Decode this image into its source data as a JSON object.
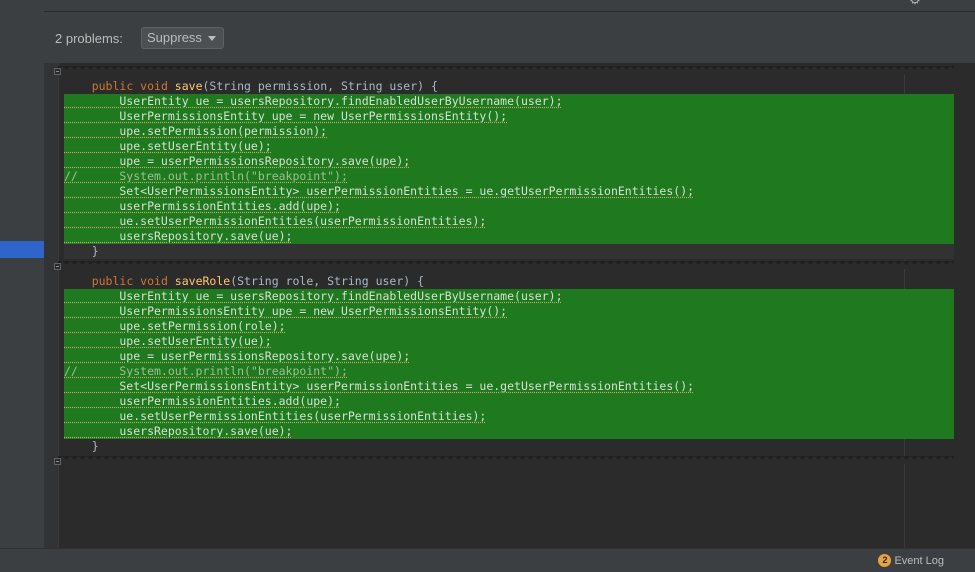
{
  "problems": {
    "count_label": "2 problems:",
    "suppress_label": "Suppress"
  },
  "code_blocks": [
    {
      "signature": {
        "pre": "public void ",
        "name": "save",
        "post": "(String permission, String user) {"
      },
      "body_lines": [
        "        UserEntity ue = usersRepository.findEnabledUserByUsername(user);",
        "        UserPermissionsEntity upe = new UserPermissionsEntity();",
        "        upe.setPermission(permission);",
        "        upe.setUserEntity(ue);",
        "        upe = userPermissionsRepository.save(upe);",
        "//      System.out.println(\"breakpoint\");",
        "        Set<UserPermissionsEntity> userPermissionEntities = ue.getUserPermissionEntities();",
        "        userPermissionEntities.add(upe);",
        "        ue.setUserPermissionEntities(userPermissionEntities);",
        "        usersRepository.save(ue);"
      ],
      "closing": "    }"
    },
    {
      "signature": {
        "pre": "public void ",
        "name": "saveRole",
        "post": "(String role, String user) {"
      },
      "body_lines": [
        "        UserEntity ue = usersRepository.findEnabledUserByUsername(user);",
        "        UserPermissionsEntity upe = new UserPermissionsEntity();",
        "        upe.setPermission(role);",
        "        upe.setUserEntity(ue);",
        "        upe = userPermissionsRepository.save(upe);",
        "//      System.out.println(\"breakpoint\");",
        "        Set<UserPermissionsEntity> userPermissionEntities = ue.getUserPermissionEntities();",
        "        userPermissionEntities.add(upe);",
        "        ue.setUserPermissionEntities(userPermissionEntities);",
        "        usersRepository.save(ue);"
      ],
      "closing": "    }"
    }
  ],
  "status_bar": {
    "event_count": "2",
    "event_log_label": "Event Log"
  },
  "icons": {
    "settings": "gear-icon",
    "dropdown": "chevron-down-icon",
    "fold": "fold-marker-icon"
  },
  "colors": {
    "diff_added": "#1f7a1f",
    "keyword": "#cc7832",
    "method_name": "#ffc66d",
    "selection": "#2f65ca"
  }
}
